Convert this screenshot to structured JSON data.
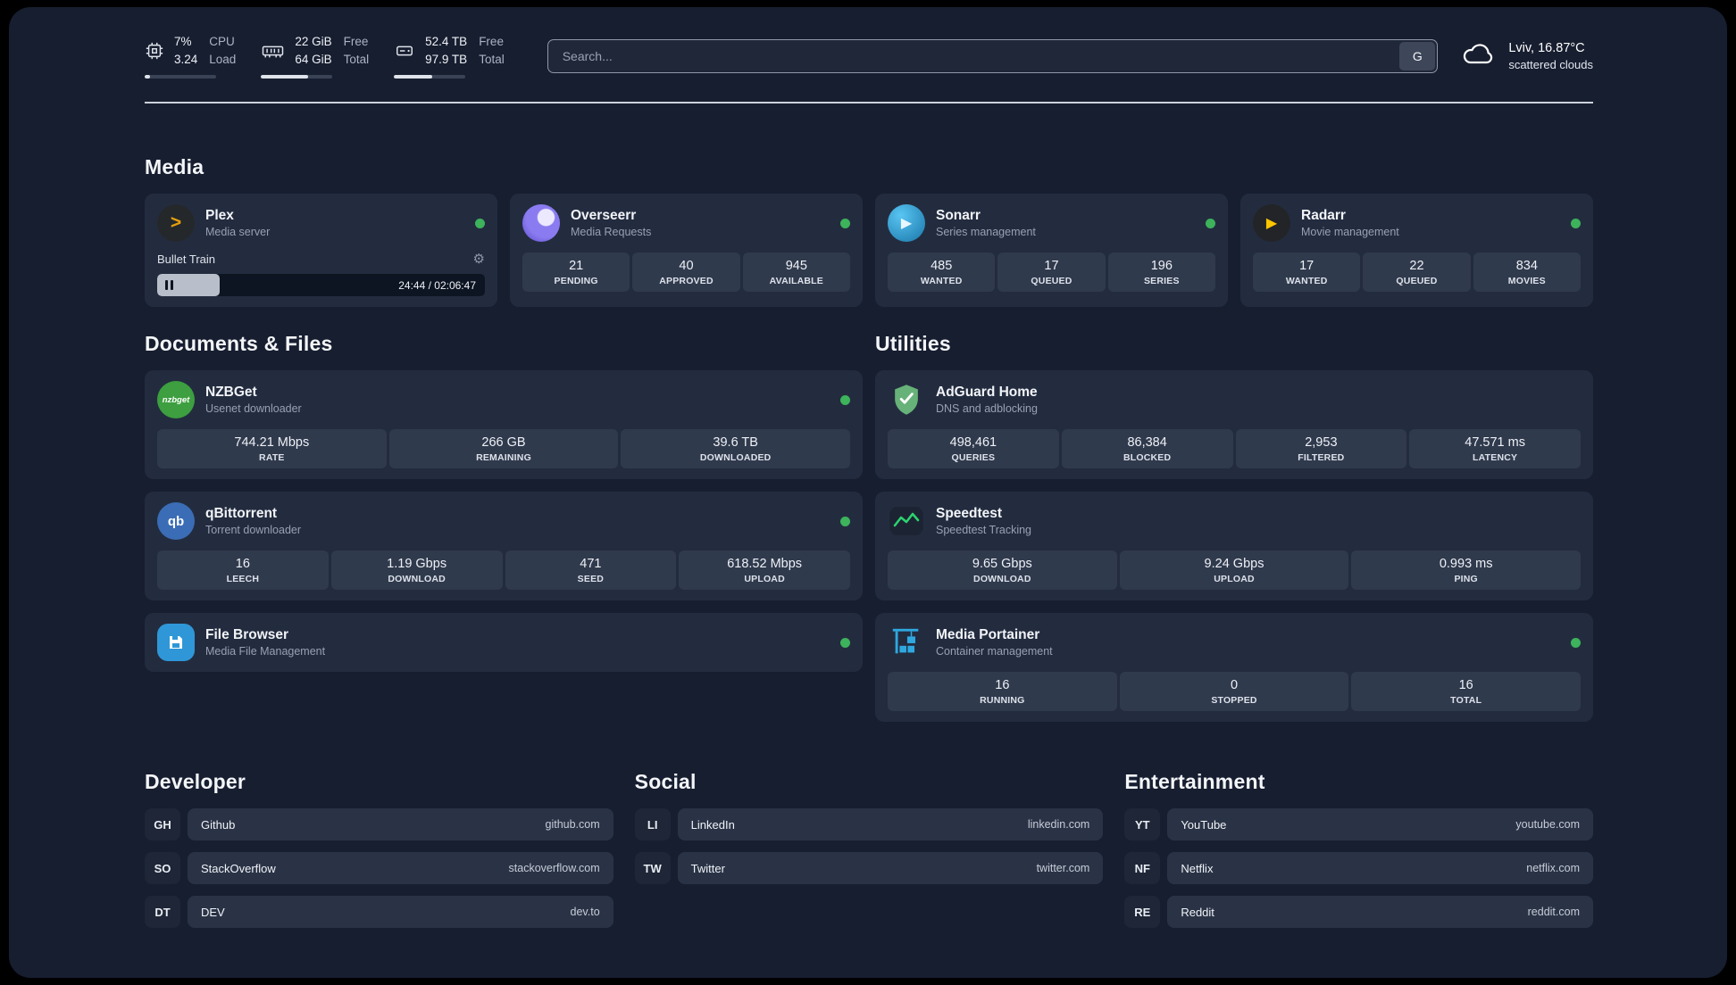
{
  "topbar": {
    "stats": [
      {
        "icon": "cpu",
        "values": [
          "7%",
          "3.24"
        ],
        "labels": [
          "CPU",
          "Load"
        ],
        "progress": 7
      },
      {
        "icon": "memory",
        "values": [
          "22 GiB",
          "64 GiB"
        ],
        "labels": [
          "Free",
          "Total"
        ],
        "progress": 66
      },
      {
        "icon": "disk",
        "values": [
          "52.4 TB",
          "97.9 TB"
        ],
        "labels": [
          "Free",
          "Total"
        ],
        "progress": 53
      }
    ],
    "search": {
      "placeholder": "Search...",
      "engine_label": "G"
    },
    "weather": {
      "location": "Lviv, 16.87°C",
      "condition": "scattered clouds"
    }
  },
  "sections": {
    "media": "Media",
    "documents": "Documents & Files",
    "utilities": "Utilities",
    "developer": "Developer",
    "social": "Social",
    "entertainment": "Entertainment"
  },
  "apps": {
    "plex": {
      "name": "Plex",
      "subtitle": "Media server",
      "icon_glyph": ">",
      "settings_icon": "⚙",
      "now_playing": "Bullet Train",
      "time": "24:44 / 02:06:47",
      "progress": 19
    },
    "overseerr": {
      "name": "Overseerr",
      "subtitle": "Media Requests",
      "stats": [
        {
          "value": "21",
          "label": "PENDING"
        },
        {
          "value": "40",
          "label": "APPROVED"
        },
        {
          "value": "945",
          "label": "AVAILABLE"
        }
      ]
    },
    "sonarr": {
      "name": "Sonarr",
      "subtitle": "Series management",
      "icon_glyph": "▶",
      "stats": [
        {
          "value": "485",
          "label": "WANTED"
        },
        {
          "value": "17",
          "label": "QUEUED"
        },
        {
          "value": "196",
          "label": "SERIES"
        }
      ]
    },
    "radarr": {
      "name": "Radarr",
      "subtitle": "Movie management",
      "icon_glyph": "▶",
      "stats": [
        {
          "value": "17",
          "label": "WANTED"
        },
        {
          "value": "22",
          "label": "QUEUED"
        },
        {
          "value": "834",
          "label": "MOVIES"
        }
      ]
    },
    "nzbget": {
      "name": "NZBGet",
      "subtitle": "Usenet downloader",
      "icon_text": "nzbget",
      "stats": [
        {
          "value": "744.21 Mbps",
          "label": "RATE"
        },
        {
          "value": "266 GB",
          "label": "REMAINING"
        },
        {
          "value": "39.6 TB",
          "label": "DOWNLOADED"
        }
      ]
    },
    "qbittorrent": {
      "name": "qBittorrent",
      "subtitle": "Torrent downloader",
      "icon_text": "qb",
      "stats": [
        {
          "value": "16",
          "label": "LEECH"
        },
        {
          "value": "1.19 Gbps",
          "label": "DOWNLOAD"
        },
        {
          "value": "471",
          "label": "SEED"
        },
        {
          "value": "618.52 Mbps",
          "label": "UPLOAD"
        }
      ]
    },
    "filebrowser": {
      "name": "File Browser",
      "subtitle": "Media File Management"
    },
    "adguard": {
      "name": "AdGuard Home",
      "subtitle": "DNS and adblocking",
      "stats": [
        {
          "value": "498,461",
          "label": "QUERIES"
        },
        {
          "value": "86,384",
          "label": "BLOCKED"
        },
        {
          "value": "2,953",
          "label": "FILTERED"
        },
        {
          "value": "47.571 ms",
          "label": "LATENCY"
        }
      ]
    },
    "speedtest": {
      "name": "Speedtest",
      "subtitle": "Speedtest Tracking",
      "stats": [
        {
          "value": "9.65 Gbps",
          "label": "DOWNLOAD"
        },
        {
          "value": "9.24 Gbps",
          "label": "UPLOAD"
        },
        {
          "value": "0.993 ms",
          "label": "PING"
        }
      ]
    },
    "portainer": {
      "name": "Media Portainer",
      "subtitle": "Container management",
      "stats": [
        {
          "value": "16",
          "label": "RUNNING"
        },
        {
          "value": "0",
          "label": "STOPPED"
        },
        {
          "value": "16",
          "label": "TOTAL"
        }
      ]
    }
  },
  "bookmarks": {
    "developer": [
      {
        "abbr": "GH",
        "name": "Github",
        "url": "github.com"
      },
      {
        "abbr": "SO",
        "name": "StackOverflow",
        "url": "stackoverflow.com"
      },
      {
        "abbr": "DT",
        "name": "DEV",
        "url": "dev.to"
      }
    ],
    "social": [
      {
        "abbr": "LI",
        "name": "LinkedIn",
        "url": "linkedin.com"
      },
      {
        "abbr": "TW",
        "name": "Twitter",
        "url": "twitter.com"
      }
    ],
    "entertainment": [
      {
        "abbr": "YT",
        "name": "YouTube",
        "url": "youtube.com"
      },
      {
        "abbr": "NF",
        "name": "Netflix",
        "url": "netflix.com"
      },
      {
        "abbr": "RE",
        "name": "Reddit",
        "url": "reddit.com"
      }
    ]
  },
  "colors": {
    "panel_background": "#171e30",
    "card_background": "#232c3f",
    "tile_background": "#303a4d",
    "status_online": "#3db35c",
    "plex_accent": "#e5a00d",
    "radarr_accent": "#fdc500",
    "sonarr_accent": "#35c5f4",
    "nzbget_accent": "#3d9f3f",
    "qbittorrent_accent": "#3a6db5",
    "adguard_accent": "#67b279",
    "speedtest_accent": "#2dd36f",
    "portainer_accent": "#2fa8e0"
  }
}
